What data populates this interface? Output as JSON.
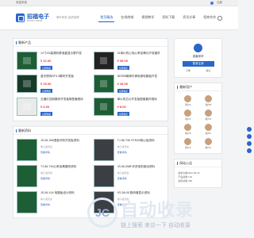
{
  "topbar": {
    "left": "欢迎来到",
    "right": "注册"
  },
  "header": {
    "logo_title": "招福电子",
    "logo_sub": "ZHAOFU DIANZI",
    "tagline": "海外研发 品质保障",
    "nav": [
      "首页精选",
      "在线商城",
      "视频教学",
      "资料下载",
      "资讯文章",
      "招商合作"
    ],
    "nav_active": 0
  },
  "products": {
    "heading": "最新产品",
    "items": [
      {
        "title": "12寸4G高清彩屏液晶显示屏开发",
        "price": "¥ 12.00",
        "btn": "立即购买"
      },
      {
        "title": "51单片机心电心率血氧仪开发套件",
        "price": "¥ 35.00",
        "btn": "立即购买"
      },
      {
        "title": "蓝牙透传BT5.0模块开发板",
        "price": "¥ 15.00",
        "btn": "立即购买"
      },
      {
        "title": "NE555微调可调电源电路板开发",
        "price": "¥ 28.00",
        "btn": "立即购买"
      },
      {
        "title": "交通灯控制模块开发板带配套程序",
        "price": "¥ 6.00",
        "btn": "立即购买"
      },
      {
        "title": "单片机芯片开发板配套套件程序",
        "price": "¥ 8.00",
        "btn": "立即购买"
      }
    ]
  },
  "resources": {
    "heading": "最新资料",
    "items": [
      {
        "title": "JS-56-358语音识别开发板资料",
        "meta": "电子发烧友",
        "link": "查看详情"
      },
      {
        "title": "TJ-56-T36 STM32核心板资料",
        "meta": "电子发烧友",
        "link": "查看详情"
      },
      {
        "title": "TJ-56-T60心率血氧模块资料",
        "meta": "电子发烧友",
        "link": "查看详情"
      },
      {
        "title": "JS-56-358F步进电机驱动资料",
        "meta": "电子发烧友",
        "link": "查看详情"
      },
      {
        "title": "JS-56-104 电路板设计资料",
        "meta": "电子发烧友",
        "link": "查看详情"
      },
      {
        "title": "KS-56-05 数码管显示资料",
        "meta": "电子发烧友",
        "link": "查看详情"
      }
    ]
  },
  "profile": {
    "name": "游客你好",
    "btn": "登录注册",
    "links": [
      "订单",
      "消息"
    ]
  },
  "users": {
    "heading": "最新用户",
    "items": [
      "用户A",
      "用户B",
      "用户C",
      "用户D",
      "用户E",
      "用户F",
      "用户G",
      "用户H"
    ]
  },
  "stats": {
    "heading": "网站公告",
    "lines": [
      "最新文章2022-05-03",
      "产品总数 120",
      "资料总数 480"
    ]
  },
  "watermark": {
    "title": "自动收录",
    "sub": "链上搜索 来访一下 自动收录"
  },
  "colors": {
    "brand": "#2a67c9",
    "price": "#e33333"
  }
}
